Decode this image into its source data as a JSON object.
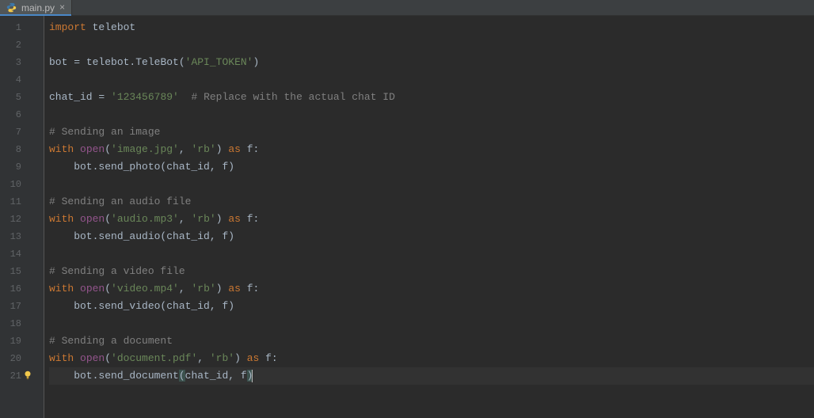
{
  "tab": {
    "filename": "main.py",
    "close_glyph": "×"
  },
  "gutter": {
    "start": 1,
    "end": 21
  },
  "highlight_line": 21,
  "code": {
    "lines": [
      [
        {
          "cls": "kw",
          "t": "import "
        },
        {
          "cls": "id",
          "t": "telebot"
        }
      ],
      [],
      [
        {
          "cls": "id",
          "t": "bot "
        },
        {
          "cls": "pn",
          "t": "= "
        },
        {
          "cls": "id",
          "t": "telebot.TeleBot("
        },
        {
          "cls": "str",
          "t": "'API_TOKEN'"
        },
        {
          "cls": "id",
          "t": ")"
        }
      ],
      [],
      [
        {
          "cls": "id",
          "t": "chat_id "
        },
        {
          "cls": "pn",
          "t": "= "
        },
        {
          "cls": "str",
          "t": "'123456789'"
        },
        {
          "cls": "cm",
          "t": "  # Replace with the actual chat ID"
        }
      ],
      [],
      [
        {
          "cls": "cm",
          "t": "# Sending an image"
        }
      ],
      [
        {
          "cls": "kw",
          "t": "with "
        },
        {
          "cls": "fn",
          "t": "open"
        },
        {
          "cls": "pn",
          "t": "("
        },
        {
          "cls": "str",
          "t": "'image.jpg'"
        },
        {
          "cls": "pn",
          "t": ", "
        },
        {
          "cls": "str",
          "t": "'rb'"
        },
        {
          "cls": "pn",
          "t": ") "
        },
        {
          "cls": "kw",
          "t": "as "
        },
        {
          "cls": "id",
          "t": "f:"
        }
      ],
      [
        {
          "cls": "id",
          "t": "    bot.send_photo(chat_id"
        },
        {
          "cls": "pn",
          "t": ", "
        },
        {
          "cls": "id",
          "t": "f)"
        }
      ],
      [],
      [
        {
          "cls": "cm",
          "t": "# Sending an audio file"
        }
      ],
      [
        {
          "cls": "kw",
          "t": "with "
        },
        {
          "cls": "fn",
          "t": "open"
        },
        {
          "cls": "pn",
          "t": "("
        },
        {
          "cls": "str",
          "t": "'audio.mp3'"
        },
        {
          "cls": "pn",
          "t": ", "
        },
        {
          "cls": "str",
          "t": "'rb'"
        },
        {
          "cls": "pn",
          "t": ") "
        },
        {
          "cls": "kw",
          "t": "as "
        },
        {
          "cls": "id",
          "t": "f:"
        }
      ],
      [
        {
          "cls": "id",
          "t": "    bot.send_audio(chat_id"
        },
        {
          "cls": "pn",
          "t": ", "
        },
        {
          "cls": "id",
          "t": "f)"
        }
      ],
      [],
      [
        {
          "cls": "cm",
          "t": "# Sending a video file"
        }
      ],
      [
        {
          "cls": "kw",
          "t": "with "
        },
        {
          "cls": "fn",
          "t": "open"
        },
        {
          "cls": "pn",
          "t": "("
        },
        {
          "cls": "str",
          "t": "'video.mp4'"
        },
        {
          "cls": "pn",
          "t": ", "
        },
        {
          "cls": "str",
          "t": "'rb'"
        },
        {
          "cls": "pn",
          "t": ") "
        },
        {
          "cls": "kw",
          "t": "as "
        },
        {
          "cls": "id",
          "t": "f:"
        }
      ],
      [
        {
          "cls": "id",
          "t": "    bot.send_video(chat_id"
        },
        {
          "cls": "pn",
          "t": ", "
        },
        {
          "cls": "id",
          "t": "f)"
        }
      ],
      [],
      [
        {
          "cls": "cm",
          "t": "# Sending a document"
        }
      ],
      [
        {
          "cls": "kw",
          "t": "with "
        },
        {
          "cls": "fn",
          "t": "open"
        },
        {
          "cls": "pn",
          "t": "("
        },
        {
          "cls": "str",
          "t": "'document.pdf'"
        },
        {
          "cls": "pn",
          "t": ", "
        },
        {
          "cls": "str",
          "t": "'rb'"
        },
        {
          "cls": "pn",
          "t": ") "
        },
        {
          "cls": "kw",
          "t": "as "
        },
        {
          "cls": "id",
          "t": "f:"
        }
      ],
      [
        {
          "cls": "id",
          "t": "    bot.send_document"
        },
        {
          "cls": "pn brm",
          "t": "("
        },
        {
          "cls": "id",
          "t": "chat_id"
        },
        {
          "cls": "pn",
          "t": ", "
        },
        {
          "cls": "id",
          "t": "f"
        },
        {
          "cls": "pn brm",
          "t": ")"
        }
      ]
    ]
  }
}
